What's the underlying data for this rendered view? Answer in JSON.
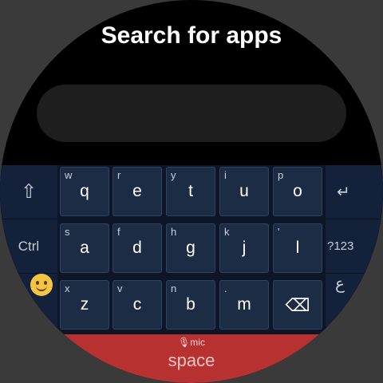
{
  "header": {
    "title": "Search for apps"
  },
  "search": {
    "value": ""
  },
  "keyboard": {
    "left_keys": {
      "shift_glyph": "⇧",
      "ctrl_label": "Ctrl",
      "emoji_icon": "smiley-emoji-icon"
    },
    "right_keys": {
      "enter_glyph": "↵",
      "symbols_label": "?123",
      "lang_glyph": "ع"
    },
    "rows": [
      [
        {
          "main": "q",
          "alt": "w"
        },
        {
          "main": "e",
          "alt": "r"
        },
        {
          "main": "t",
          "alt": "y"
        },
        {
          "main": "u",
          "alt": "i"
        },
        {
          "main": "o",
          "alt": "p"
        }
      ],
      [
        {
          "main": "a",
          "alt": "s"
        },
        {
          "main": "d",
          "alt": "f"
        },
        {
          "main": "g",
          "alt": "h"
        },
        {
          "main": "j",
          "alt": "k"
        },
        {
          "main": "l",
          "alt": "'"
        }
      ],
      [
        {
          "main": "z",
          "alt": "x"
        },
        {
          "main": "c",
          "alt": "v"
        },
        {
          "main": "b",
          "alt": "n"
        },
        {
          "main": "m",
          "alt": "."
        },
        {
          "main": "⌫",
          "alt": ""
        }
      ]
    ],
    "space": {
      "mic_glyph": "🎙",
      "mic_label": "mic",
      "label": "space"
    }
  },
  "colors": {
    "keyboard_bg": "#0c1627",
    "key_bg": "#1d2c45",
    "space_bar": "#b83131"
  }
}
